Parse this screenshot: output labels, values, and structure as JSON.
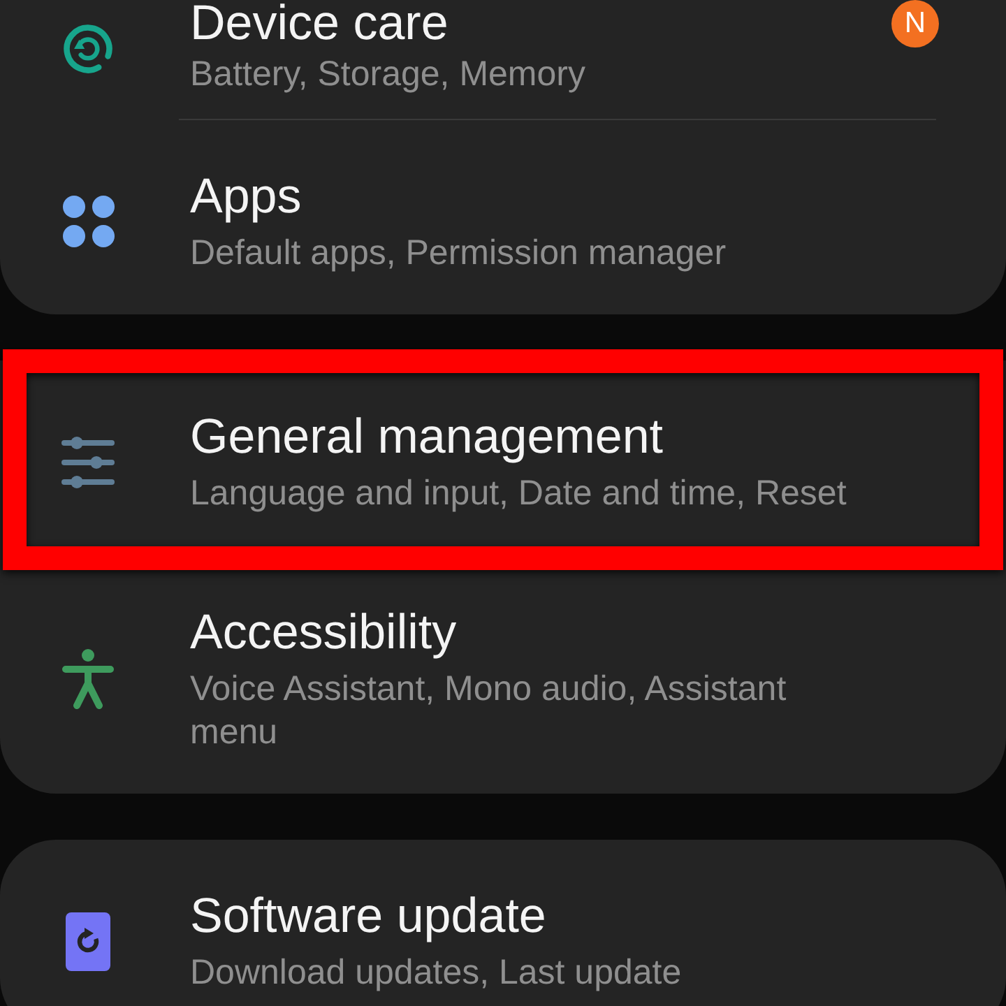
{
  "sections": [
    {
      "items": [
        {
          "title": "Device care",
          "subtitle": "Battery, Storage, Memory",
          "color": "#17a58c",
          "badge": "N",
          "highlighted": false
        },
        {
          "title": "Apps",
          "subtitle": "Default apps, Permission manager",
          "color": "#74a9f2",
          "highlighted": false
        }
      ]
    },
    {
      "items": [
        {
          "title": "General management",
          "subtitle": "Language and input, Date and time, Reset",
          "color": "#5f7d95",
          "highlighted": true
        },
        {
          "title": "Accessibility",
          "subtitle": "Voice Assistant, Mono audio, Assistant menu",
          "color": "#3e9b5d",
          "highlighted": false
        }
      ]
    },
    {
      "items": [
        {
          "title": "Software update",
          "subtitle": "Download updates, Last update",
          "color": "#7474f5",
          "highlighted": false
        }
      ]
    }
  ]
}
